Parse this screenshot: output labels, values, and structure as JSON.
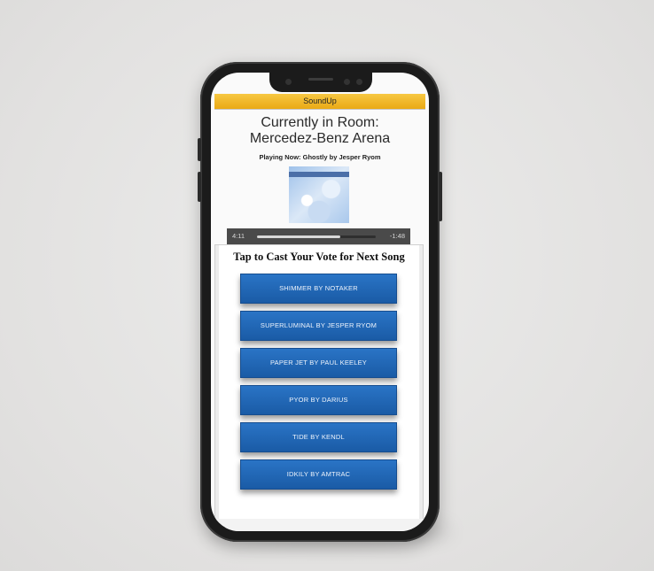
{
  "app": {
    "title": "SoundUp"
  },
  "room": {
    "title_line1": "Currently in Room:",
    "title_line2": "Mercedez-Benz Arena",
    "playing_now": "Playing Now: Ghostly by Jesper Ryom"
  },
  "album": {
    "icon": "album-art"
  },
  "player": {
    "elapsed": "4:11",
    "remaining": "-1:48",
    "progress": 0.7
  },
  "vote": {
    "heading": "Tap to Cast Your Vote for Next Song",
    "songs": [
      "SHIMMER BY NOTAKER",
      "SUPERLUMINAL BY JESPER RYOM",
      "PAPER JET BY PAUL KEELEY",
      "PYOR BY DARIUS",
      "TIDE BY KENDL",
      "IDKILY BY AMTRAC"
    ]
  },
  "colors": {
    "appbar": "#f2bb2c",
    "button": "#1f65b3",
    "player": "#4a4a4a"
  }
}
